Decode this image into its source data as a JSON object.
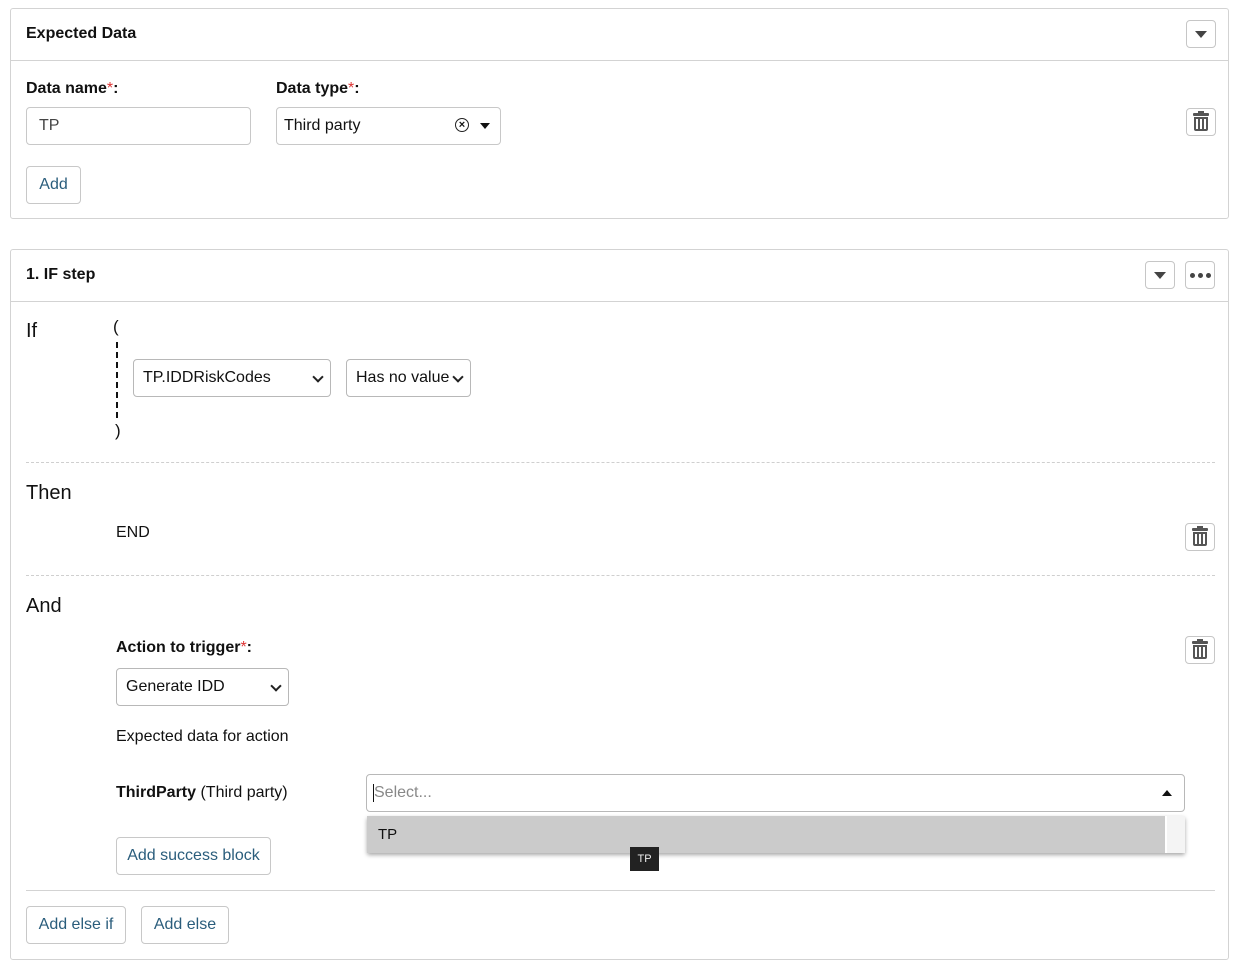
{
  "expected_data": {
    "title": "Expected Data",
    "data_name_label": "Data name",
    "data_type_label": "Data type",
    "required_mark": "*",
    "label_suffix": ":",
    "data_name_value": "TP",
    "data_type_value": "Third party",
    "add_label": "Add"
  },
  "if_step": {
    "title": "1. IF step",
    "if_word": "If",
    "open_paren": "(",
    "close_paren": ")",
    "field_select": "TP.IDDRiskCodes",
    "operator_select": "Has no value",
    "then_word": "Then",
    "then_value": "END",
    "and_word": "And",
    "action_label": "Action to trigger",
    "action_select": "Generate IDD",
    "expected_data_for_action": "Expected data for action",
    "param_name": "ThirdParty",
    "param_type": "(Third party)",
    "param_placeholder": "Select...",
    "dropdown_option": "TP",
    "tooltip": "TP",
    "add_success_block": "Add success block",
    "add_else_if": "Add else if",
    "add_else": "Add else"
  },
  "icons": {
    "collapse": "caret-down-icon",
    "more": "ellipsis-icon",
    "delete": "trash-icon",
    "clear": "clear-x-icon"
  }
}
